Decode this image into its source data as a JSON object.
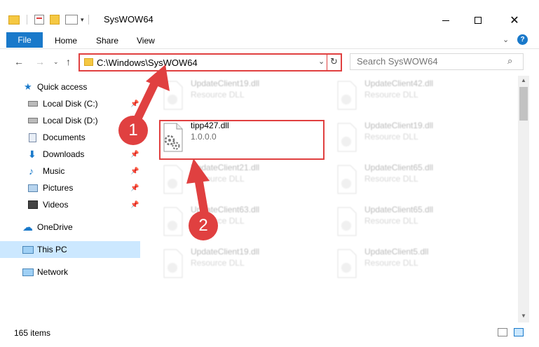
{
  "window": {
    "title": "SysWOW64",
    "controls": [
      "minimize-icon",
      "maximize-icon",
      "close-icon"
    ]
  },
  "ribbon": {
    "tabs": [
      {
        "label": "File"
      },
      {
        "label": "Home"
      },
      {
        "label": "Share"
      },
      {
        "label": "View"
      }
    ],
    "help_icon": "help-icon"
  },
  "address": {
    "path": "C:\\Windows\\SysWOW64",
    "search_placeholder": "Search SysWOW64"
  },
  "sidebar": {
    "items": [
      {
        "label": "Quick access",
        "icon": "star-icon"
      },
      {
        "label": "Local Disk (C:)",
        "icon": "drive-icon",
        "pinned": true
      },
      {
        "label": "Local Disk (D:)",
        "icon": "drive-icon"
      },
      {
        "label": "Documents",
        "icon": "documents-icon",
        "pinned": true
      },
      {
        "label": "Downloads",
        "icon": "download-icon",
        "pinned": true
      },
      {
        "label": "Music",
        "icon": "music-icon",
        "pinned": true
      },
      {
        "label": "Pictures",
        "icon": "pictures-icon",
        "pinned": true
      },
      {
        "label": "Videos",
        "icon": "videos-icon",
        "pinned": true
      },
      {
        "label": "OneDrive",
        "icon": "cloud-icon"
      },
      {
        "label": "This PC",
        "icon": "pc-icon",
        "selected": true
      },
      {
        "label": "Network",
        "icon": "network-icon"
      }
    ]
  },
  "files": {
    "highlighted": {
      "name": "tipp427.dll",
      "version": "1.0.0.0"
    },
    "left": [
      {
        "name": "UpdateClient19.dll",
        "type": "Resource DLL"
      },
      {
        "name": "UpdateClient21.dll",
        "type": "Resource DLL"
      },
      {
        "name": "UpdateClient63.dll",
        "type": "Resource DLL"
      },
      {
        "name": "UpdateClient19.dll",
        "type": "Resource DLL"
      }
    ],
    "right": [
      {
        "name": "UpdateClient42.dll",
        "type": "Resource DLL"
      },
      {
        "name": "UpdateClient19.dll",
        "type": "Resource DLL"
      },
      {
        "name": "UpdateClient65.dll",
        "type": "Resource DLL"
      },
      {
        "name": "UpdateClient65.dll",
        "type": "Resource DLL"
      },
      {
        "name": "UpdateClient5.dll",
        "type": "Resource DLL"
      }
    ]
  },
  "annotations": {
    "step1": "1",
    "step2": "2",
    "color": "#e04040"
  },
  "status": {
    "item_count": "165 items"
  },
  "colors": {
    "accent": "#1979ca",
    "selection": "#cce8ff",
    "highlight_box": "#e04040"
  }
}
